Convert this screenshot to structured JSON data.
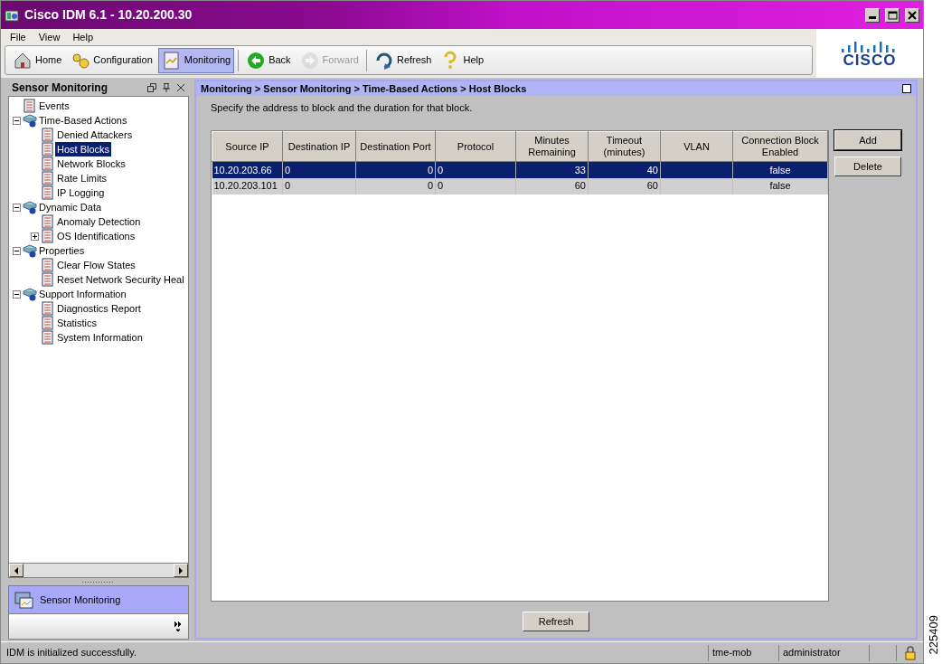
{
  "window": {
    "title": "Cisco IDM 6.1 - 10.20.200.30"
  },
  "menu": [
    "File",
    "View",
    "Help"
  ],
  "toolbar": [
    {
      "label": "Home",
      "selected": false,
      "disabled": false
    },
    {
      "label": "Configuration",
      "selected": false,
      "disabled": false
    },
    {
      "label": "Monitoring",
      "selected": true,
      "disabled": false
    },
    {
      "label": "Back",
      "selected": false,
      "disabled": false
    },
    {
      "label": "Forward",
      "selected": false,
      "disabled": true
    },
    {
      "label": "Refresh",
      "selected": false,
      "disabled": false
    },
    {
      "label": "Help",
      "selected": false,
      "disabled": false
    }
  ],
  "logo": {
    "text": "CISCO"
  },
  "sidebar": {
    "title": "Sensor Monitoring",
    "items": [
      {
        "label": "Events",
        "selected": false
      },
      {
        "label": "Time-Based Actions",
        "selected": false,
        "expanded": true,
        "children": [
          {
            "label": "Denied Attackers",
            "selected": false
          },
          {
            "label": "Host Blocks",
            "selected": true
          },
          {
            "label": "Network Blocks",
            "selected": false
          },
          {
            "label": "Rate Limits",
            "selected": false
          },
          {
            "label": "IP Logging",
            "selected": false
          }
        ]
      },
      {
        "label": "Dynamic Data",
        "selected": false,
        "expanded": true,
        "children": [
          {
            "label": "Anomaly Detection",
            "selected": false
          },
          {
            "label": "OS Identifications",
            "selected": false,
            "expanded": false
          }
        ]
      },
      {
        "label": "Properties",
        "selected": false,
        "expanded": true,
        "children": [
          {
            "label": "Clear Flow States",
            "selected": false
          },
          {
            "label": "Reset Network Security Heal",
            "selected": false
          }
        ]
      },
      {
        "label": "Support Information",
        "selected": false,
        "expanded": true,
        "children": [
          {
            "label": "Diagnostics Report",
            "selected": false
          },
          {
            "label": "Statistics",
            "selected": false
          },
          {
            "label": "System Information",
            "selected": false
          }
        ]
      }
    ],
    "nav_button": "Sensor Monitoring"
  },
  "content": {
    "breadcrumb": "Monitoring > Sensor Monitoring > Time-Based Actions > Host Blocks",
    "description": "Specify the address to block and the duration for that block.",
    "table": {
      "columns": [
        "Source IP",
        "Destination IP",
        "Destination Port",
        "Protocol",
        "Minutes Remaining",
        "Timeout (minutes)",
        "VLAN",
        "Connection Block Enabled"
      ],
      "rows": [
        {
          "source_ip": "10.20.203.66",
          "destination_ip": "0",
          "destination_port": "0",
          "protocol": "0",
          "minutes_remaining": "33",
          "timeout": "40",
          "connection_block_enabled": "false",
          "selected": true
        },
        {
          "source_ip": "10.20.203.101",
          "destination_ip": "0",
          "destination_port": "0",
          "protocol": "0",
          "minutes_remaining": "60",
          "timeout": "60",
          "connection_block_enabled": "false",
          "selected": false
        }
      ]
    },
    "side_buttons": [
      "Add",
      "Delete"
    ],
    "refresh_button": "Refresh"
  },
  "status_bar": {
    "message": "IDM is initialized successfully.",
    "host": "tme-mob",
    "user": "administrator"
  },
  "figure_number": "225409"
}
